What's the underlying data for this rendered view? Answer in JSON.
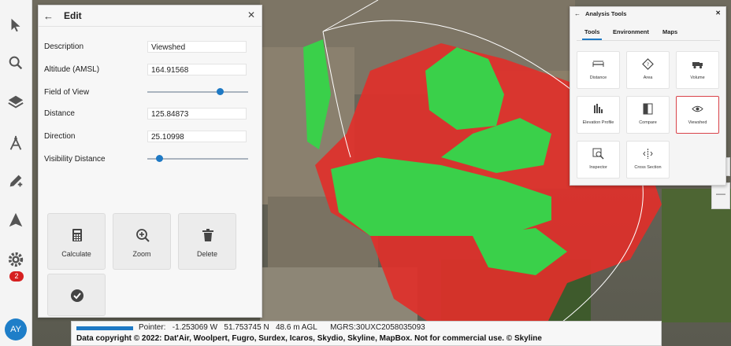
{
  "toolbar": {
    "items": [
      "pointer-icon",
      "search-icon",
      "layers-icon",
      "measure-icon",
      "edit-icon",
      "navigate-icon",
      "settings-icon"
    ],
    "settings_badge": "2",
    "avatar_initials": "AY"
  },
  "edit_panel": {
    "title": "Edit",
    "fields": {
      "description_label": "Description",
      "description_value": "Viewshed",
      "altitude_label": "Altitude (AMSL)",
      "altitude_value": "164.91568",
      "fov_label": "Field of View",
      "fov_level": 0.72,
      "distance_label": "Distance",
      "distance_value": "125.84873",
      "direction_label": "Direction",
      "direction_value": "25.10998",
      "visibility_label": "Visibility Distance",
      "visibility_level": 0.12
    },
    "actions": {
      "calculate": "Calculate",
      "zoom": "Zoom",
      "delete": "Delete"
    }
  },
  "analysis_tools": {
    "title": "Analysis Tools",
    "tabs": [
      "Tools",
      "Environment",
      "Maps"
    ],
    "active_tab": "Tools",
    "items": {
      "distance": "Distance",
      "area": "Area",
      "volume": "Volume",
      "elevation_profile": "Elevation Profile",
      "compare": "Compare",
      "viewshed": "Viewshed",
      "inspector": "Inspector",
      "cross_section": "Cross Section"
    },
    "selected": "Viewshed"
  },
  "status_bar": {
    "pointer": "Pointer:   -1.253069 W   51.753745 N   48.6 m AGL      MGRS:30UXC2058035093",
    "copyright": "Data copyright © 2022: Dat'Air, Woolpert, Fugro, Surdex, Icaros, Skydio, Skyline, MapBox. Not for commercial use. © Skyline"
  },
  "colors": {
    "visible": "#3ad04a",
    "hidden": "#e0302a",
    "accent": "#1e79c4"
  }
}
